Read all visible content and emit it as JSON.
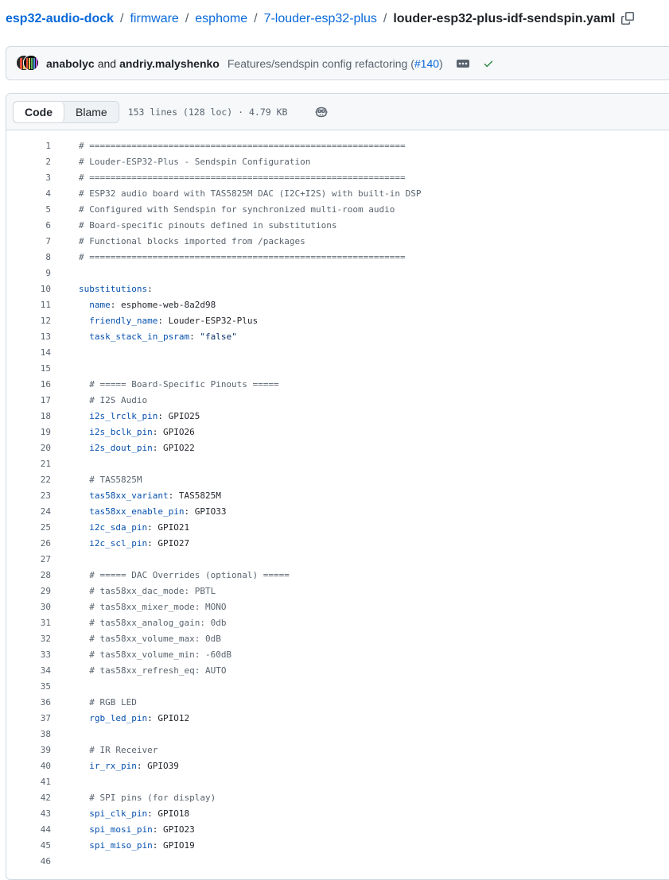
{
  "breadcrumb": {
    "repo": "esp32-audio-dock",
    "separator": "/",
    "dirs": [
      "firmware",
      "esphome",
      "7-louder-esp32-plus"
    ],
    "file": "louder-esp32-plus-idf-sendspin.yaml"
  },
  "commit": {
    "author1": "anabolyc",
    "and": "and",
    "author2": "andriy.malyshenko",
    "message": "Features/sendspin config refactoring (",
    "pr": "#140",
    "message_end": ")"
  },
  "file_header": {
    "tab_code": "Code",
    "tab_blame": "Blame",
    "meta": "153 lines (128 loc) · 4.79 KB"
  },
  "code_lines": [
    {
      "n": "1",
      "indent": "",
      "comment": "# ============================================================"
    },
    {
      "n": "2",
      "indent": "",
      "comment": "# Louder-ESP32-Plus - Sendspin Configuration"
    },
    {
      "n": "3",
      "indent": "",
      "comment": "# ============================================================"
    },
    {
      "n": "4",
      "indent": "",
      "comment": "# ESP32 audio board with TAS5825M DAC (I2C+I2S) with built-in DSP"
    },
    {
      "n": "5",
      "indent": "",
      "comment": "# Configured with Sendspin for synchronized multi-room audio"
    },
    {
      "n": "6",
      "indent": "",
      "comment": "# Board-specific pinouts defined in substitutions"
    },
    {
      "n": "7",
      "indent": "",
      "comment": "# Functional blocks imported from /packages"
    },
    {
      "n": "8",
      "indent": "",
      "comment": "# ============================================================"
    },
    {
      "n": "9",
      "indent": ""
    },
    {
      "n": "10",
      "indent": "",
      "key": "substitutions"
    },
    {
      "n": "11",
      "indent": "  ",
      "key": "name",
      "value": "esphome-web-8a2d98"
    },
    {
      "n": "12",
      "indent": "  ",
      "key": "friendly_name",
      "value": "Louder-ESP32-Plus"
    },
    {
      "n": "13",
      "indent": "  ",
      "key": "task_stack_in_psram",
      "string": "\"false\""
    },
    {
      "n": "14",
      "indent": ""
    },
    {
      "n": "15",
      "indent": ""
    },
    {
      "n": "16",
      "indent": "  ",
      "comment": "# ===== Board-Specific Pinouts ====="
    },
    {
      "n": "17",
      "indent": "  ",
      "comment": "# I2S Audio"
    },
    {
      "n": "18",
      "indent": "  ",
      "key": "i2s_lrclk_pin",
      "value": "GPIO25"
    },
    {
      "n": "19",
      "indent": "  ",
      "key": "i2s_bclk_pin",
      "value": "GPIO26"
    },
    {
      "n": "20",
      "indent": "  ",
      "key": "i2s_dout_pin",
      "value": "GPIO22"
    },
    {
      "n": "21",
      "indent": ""
    },
    {
      "n": "22",
      "indent": "  ",
      "comment": "# TAS5825M"
    },
    {
      "n": "23",
      "indent": "  ",
      "key": "tas58xx_variant",
      "value": "TAS5825M"
    },
    {
      "n": "24",
      "indent": "  ",
      "key": "tas58xx_enable_pin",
      "value": "GPIO33"
    },
    {
      "n": "25",
      "indent": "  ",
      "key": "i2c_sda_pin",
      "value": "GPIO21"
    },
    {
      "n": "26",
      "indent": "  ",
      "key": "i2c_scl_pin",
      "value": "GPIO27"
    },
    {
      "n": "27",
      "indent": ""
    },
    {
      "n": "28",
      "indent": "  ",
      "comment": "# ===== DAC Overrides (optional) ====="
    },
    {
      "n": "29",
      "indent": "  ",
      "comment": "# tas58xx_dac_mode: PBTL"
    },
    {
      "n": "30",
      "indent": "  ",
      "comment": "# tas58xx_mixer_mode: MONO"
    },
    {
      "n": "31",
      "indent": "  ",
      "comment": "# tas58xx_analog_gain: 0db"
    },
    {
      "n": "32",
      "indent": "  ",
      "comment": "# tas58xx_volume_max: 0dB"
    },
    {
      "n": "33",
      "indent": "  ",
      "comment": "# tas58xx_volume_min: -60dB"
    },
    {
      "n": "34",
      "indent": "  ",
      "comment": "# tas58xx_refresh_eq: AUTO"
    },
    {
      "n": "35",
      "indent": ""
    },
    {
      "n": "36",
      "indent": "  ",
      "comment": "# RGB LED"
    },
    {
      "n": "37",
      "indent": "  ",
      "key": "rgb_led_pin",
      "value": "GPIO12"
    },
    {
      "n": "38",
      "indent": ""
    },
    {
      "n": "39",
      "indent": "  ",
      "comment": "# IR Receiver"
    },
    {
      "n": "40",
      "indent": "  ",
      "key": "ir_rx_pin",
      "value": "GPIO39"
    },
    {
      "n": "41",
      "indent": ""
    },
    {
      "n": "42",
      "indent": "  ",
      "comment": "# SPI pins (for display)"
    },
    {
      "n": "43",
      "indent": "  ",
      "key": "spi_clk_pin",
      "value": "GPIO18"
    },
    {
      "n": "44",
      "indent": "  ",
      "key": "spi_mosi_pin",
      "value": "GPIO23"
    },
    {
      "n": "45",
      "indent": "  ",
      "key": "spi_miso_pin",
      "value": "GPIO19"
    },
    {
      "n": "46",
      "indent": ""
    }
  ],
  "icons": {
    "copy": "copy-icon",
    "ellipsis": "ellipsis-icon",
    "check": "check-icon",
    "copilot": "copilot-icon"
  },
  "colors": {
    "link": "#0969da",
    "key": "#0550ae",
    "comment": "#59636e",
    "success": "#1a7f37",
    "string": "#0a3069"
  }
}
